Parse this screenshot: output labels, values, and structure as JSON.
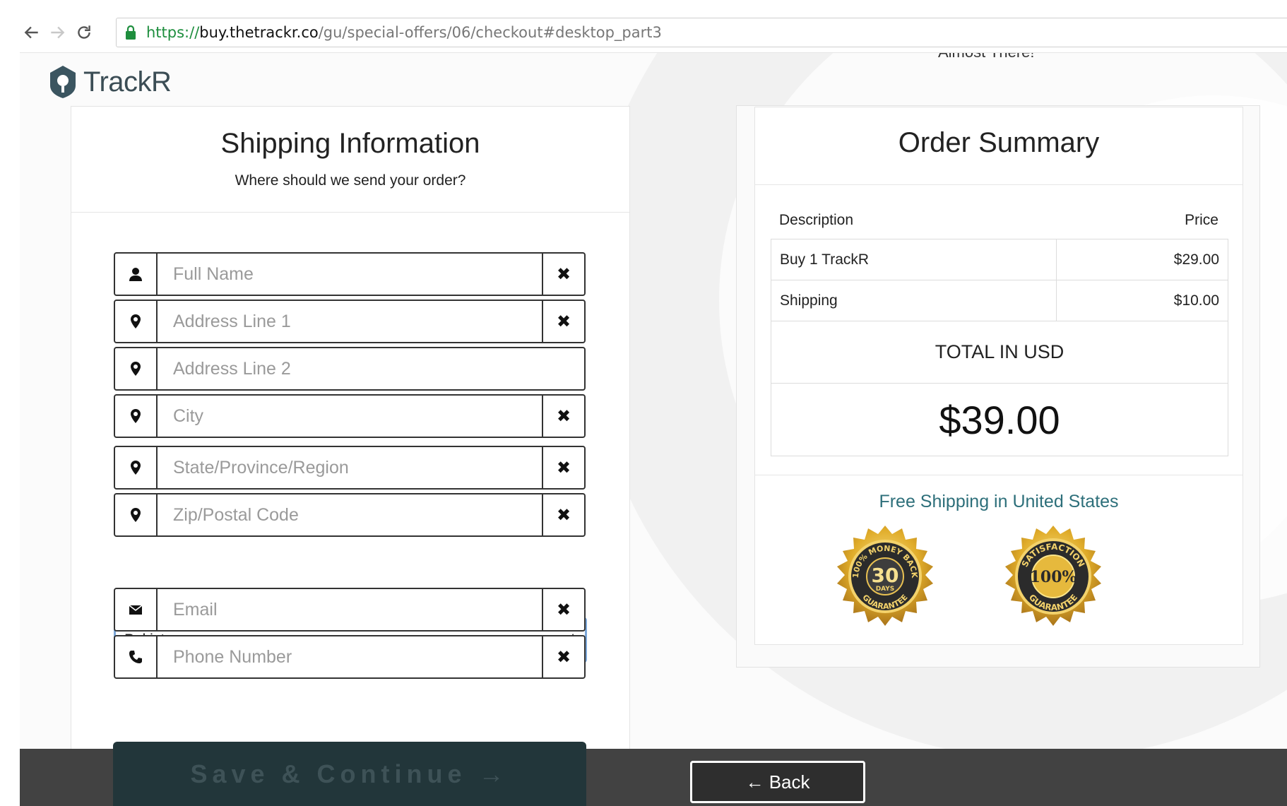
{
  "browser": {
    "url_scheme": "https://",
    "url_host": "buy.thetrackr.co",
    "url_path": "/gu/special-offers/06/checkout#desktop_part3"
  },
  "page": {
    "almost_text": "Almost There!",
    "logo_text": "TrackR"
  },
  "shipping": {
    "title": "Shipping Information",
    "subtitle": "Where should we send your order?",
    "fields": [
      {
        "placeholder": "Full Name",
        "icon": "user-icon"
      },
      {
        "placeholder": "Address Line 1",
        "icon": "map-marker-icon"
      },
      {
        "placeholder": "Address Line 2",
        "icon": "map-marker-icon"
      },
      {
        "placeholder": "City",
        "icon": "map-marker-icon"
      },
      {
        "placeholder": "State/Province/Region",
        "icon": "map-marker-icon"
      },
      {
        "placeholder": "Zip/Postal Code",
        "icon": "map-marker-icon"
      },
      {
        "placeholder": "Email",
        "icon": "envelope-icon"
      },
      {
        "placeholder": "Phone Number",
        "icon": "phone-icon"
      }
    ],
    "clear_glyph": "✖",
    "country": "Pakistan",
    "save_label": "Save & Continue →"
  },
  "order": {
    "title": "Order Summary",
    "desc_header": "Description",
    "price_header": "Price",
    "rows": [
      {
        "description": "Buy 1 TrackR",
        "price": "$29.00"
      },
      {
        "description": "Shipping",
        "price": "$10.00"
      }
    ],
    "total_label": "TOTAL IN USD",
    "total_amount": "$39.00",
    "free_shipping": "Free Shipping in United States",
    "badge1": {
      "top": "100% MONEY BACK",
      "big": "30",
      "small": "DAYS",
      "bottom": "GUARANTEE"
    },
    "badge2": {
      "top": "SATISFACTION",
      "big": "100%",
      "bottom": "GUARANTEE"
    }
  },
  "footer": {
    "back_label": "← Back"
  },
  "colors": {
    "accent_teal": "#2d6f7a",
    "save_button": "#22363a",
    "footer_bar": "#424242",
    "select_focus": "#7aa6d8"
  }
}
